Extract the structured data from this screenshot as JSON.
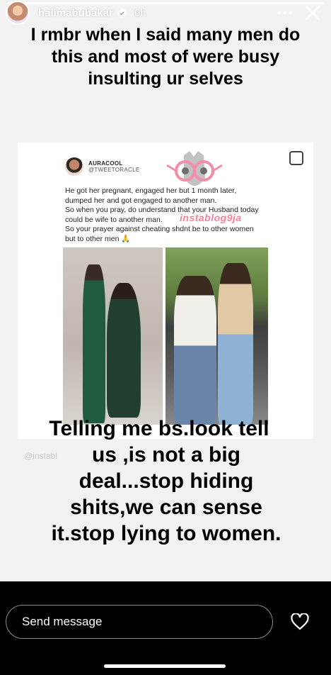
{
  "story": {
    "username": "halimabubakar",
    "time": "6h",
    "progress": 1.0,
    "icons": {
      "verified": "verified-badge-icon",
      "more": "more-icon",
      "close": "close-icon"
    },
    "caption": "I rmbr when I said many men do this and most of were busy insulting ur selves"
  },
  "post": {
    "author_name": "AURACOOL",
    "author_handle": "@TWEETORACLE",
    "tweet_lines": [
      "He got her pregnant, engaged her but 1 month later,",
      "dumped her and got engaged to another man.",
      "So when you pray, do understand that your Husband today",
      "could be wife to another man.",
      "So your prayer against cheating shdnt be to other women",
      "but to other men 🙏"
    ],
    "watermark": "instablog9ja",
    "faint_watermark": "@instabl"
  },
  "overlay_text": {
    "line1": "Telling me bs.look tell",
    "line2": "us ,is not a big",
    "line3": "deal...stop hiding",
    "line4": "shits,we can sense",
    "line5": "it.stop lying to women."
  },
  "reply": {
    "placeholder": "Send message",
    "icons": {
      "like": "heart-icon"
    }
  }
}
